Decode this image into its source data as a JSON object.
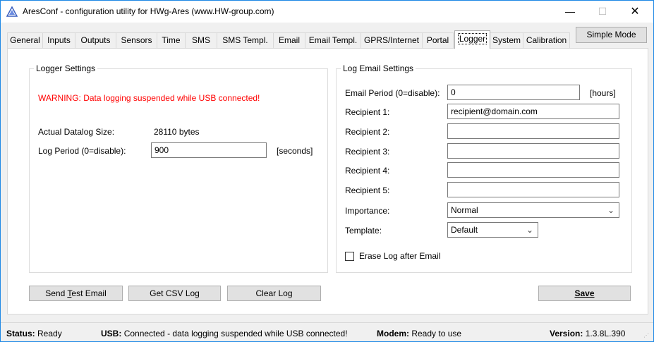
{
  "window": {
    "title": "AresConf - configuration utility for HWg-Ares (www.HW-group.com)",
    "controls": {
      "minimize": "—",
      "maximize": "☐",
      "close": "✕"
    }
  },
  "tabs": [
    {
      "label": "General"
    },
    {
      "label": "Inputs"
    },
    {
      "label": "Outputs"
    },
    {
      "label": "Sensors"
    },
    {
      "label": "Time"
    },
    {
      "label": "SMS"
    },
    {
      "label": "SMS Templ."
    },
    {
      "label": "Email"
    },
    {
      "label": "Email Templ."
    },
    {
      "label": "GPRS/Internet"
    },
    {
      "label": "Portal"
    },
    {
      "label": "Logger",
      "active": true
    },
    {
      "label": "System"
    },
    {
      "label": "Calibration"
    }
  ],
  "simple_mode_label": "Simple Mode",
  "logger_settings": {
    "title": "Logger Settings",
    "warning": "WARNING: Data logging suspended while USB connected!",
    "datalog_size_label": "Actual Datalog Size:",
    "datalog_size_value": "28110 bytes",
    "log_period_label": "Log Period (0=disable):",
    "log_period_value": "900",
    "log_period_unit": "[seconds]"
  },
  "log_email_settings": {
    "title": "Log Email Settings",
    "email_period_label": "Email Period (0=disable):",
    "email_period_value": "0",
    "email_period_unit": "[hours]",
    "recipients": [
      {
        "label": "Recipient 1:",
        "value": "recipient@domain.com"
      },
      {
        "label": "Recipient 2:",
        "value": ""
      },
      {
        "label": "Recipient 3:",
        "value": ""
      },
      {
        "label": "Recipient 4:",
        "value": ""
      },
      {
        "label": "Recipient 5:",
        "value": ""
      }
    ],
    "importance_label": "Importance:",
    "importance_value": "Normal",
    "template_label": "Template:",
    "template_value": "Default",
    "erase_log_label": "Erase Log after Email",
    "erase_log_checked": false
  },
  "buttons": {
    "send_test_email_prefix": "Send ",
    "send_test_email_accel": "T",
    "send_test_email_suffix": "est Email",
    "get_csv_log": "Get CSV Log",
    "clear_log": "Clear Log",
    "save": "Save"
  },
  "status": {
    "status_label": "Status:",
    "status_value": "Ready",
    "usb_label": "USB:",
    "usb_value": "Connected - data logging suspended while USB connected!",
    "modem_label": "Modem:",
    "modem_value": "Ready to use",
    "version_label": "Version:",
    "version_value": "1.3.8L.390"
  },
  "colors": {
    "warning": "#ff0000",
    "window_border": "#1e88e5"
  },
  "icons": {
    "app": "ares-triangle-icon",
    "dropdown": "chevron-down-icon",
    "resize": "resize-grip-icon"
  }
}
